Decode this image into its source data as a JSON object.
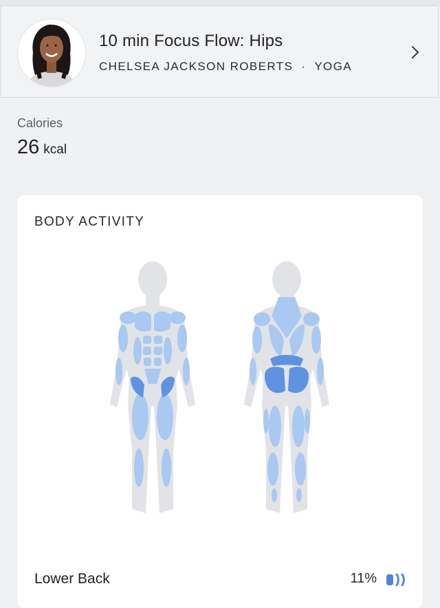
{
  "class": {
    "title": "10 min Focus Flow: Hips",
    "instructor": "CHELSEA JACKSON ROBERTS",
    "separator": "·",
    "discipline": "YOGA"
  },
  "calories": {
    "label": "Calories",
    "value": "26",
    "unit": "kcal"
  },
  "body_activity": {
    "title": "BODY ACTIVITY",
    "colors": {
      "silhouette": "#e2e3e6",
      "muscle_light": "#a9c8f2",
      "muscle_dark": "#5f93e0"
    },
    "muscles": [
      {
        "name": "Lower Back",
        "percent": "11%",
        "intensity_bars_filled": 1,
        "intensity_bars_total": 3
      }
    ]
  },
  "icons": {
    "chevron": "chevron-right-icon",
    "avatar": "instructor-avatar",
    "intensity": "intensity-bars-icon"
  }
}
